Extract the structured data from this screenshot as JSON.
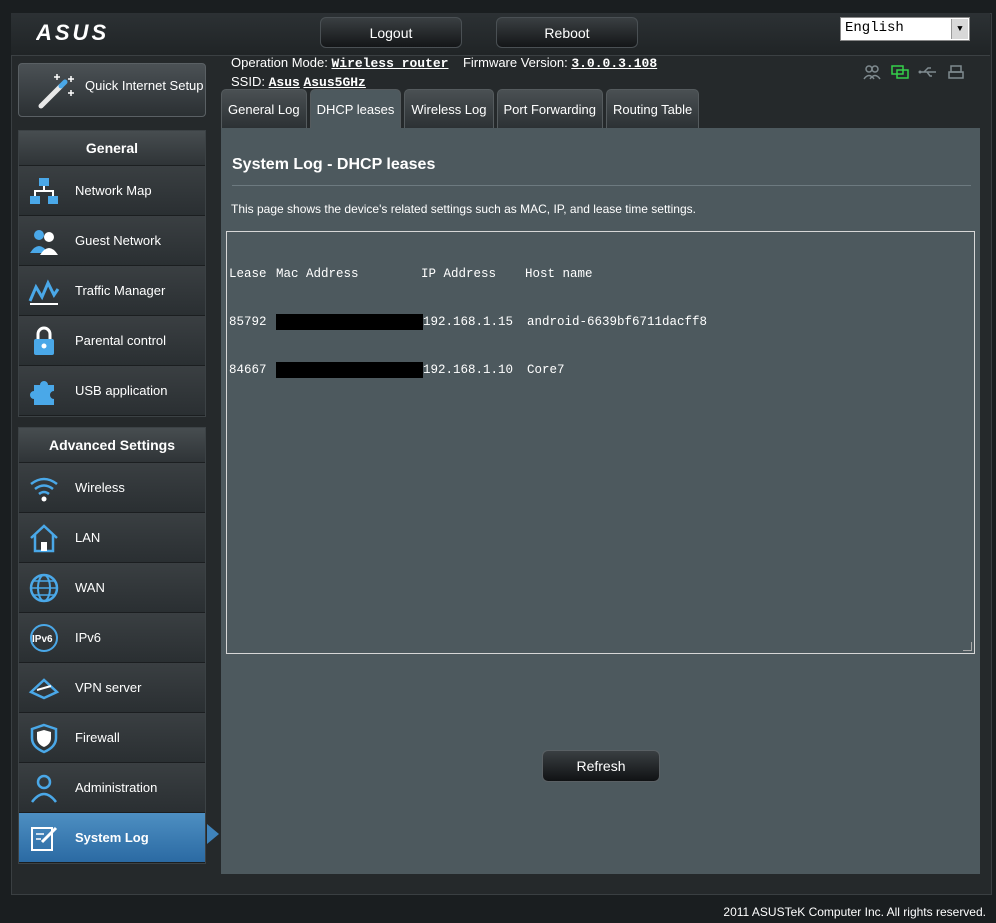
{
  "header": {
    "logo": "/ISUS",
    "logout_label": "Logout",
    "reboot_label": "Reboot",
    "language": "English"
  },
  "info": {
    "operation_mode_label": "Operation Mode:",
    "operation_mode_value": "Wireless router",
    "firmware_label": "Firmware Version:",
    "firmware_value": "3.0.0.3.108",
    "ssid_label": "SSID:",
    "ssid_1": "Asus",
    "ssid_2": "Asus5GHz"
  },
  "status_icons": [
    "clients-icon",
    "network-icon",
    "usb-icon",
    "printer-icon"
  ],
  "sidebar": {
    "qis_label": "Quick Internet Setup",
    "general_title": "General",
    "general_items": [
      {
        "label": "Network Map",
        "icon": "network-map-icon"
      },
      {
        "label": "Guest Network",
        "icon": "guest-network-icon"
      },
      {
        "label": "Traffic Manager",
        "icon": "traffic-manager-icon"
      },
      {
        "label": "Parental control",
        "icon": "lock-icon"
      },
      {
        "label": "USB application",
        "icon": "puzzle-icon"
      }
    ],
    "advanced_title": "Advanced Settings",
    "advanced_items": [
      {
        "label": "Wireless",
        "icon": "wifi-icon"
      },
      {
        "label": "LAN",
        "icon": "house-icon"
      },
      {
        "label": "WAN",
        "icon": "globe-icon"
      },
      {
        "label": "IPv6",
        "icon": "ipv6-icon"
      },
      {
        "label": "VPN server",
        "icon": "vpn-icon"
      },
      {
        "label": "Firewall",
        "icon": "shield-icon"
      },
      {
        "label": "Administration",
        "icon": "admin-user-icon"
      },
      {
        "label": "System Log",
        "icon": "log-icon"
      }
    ]
  },
  "tabs": [
    "General Log",
    "DHCP leases",
    "Wireless Log",
    "Port Forwarding",
    "Routing Table"
  ],
  "active_tab": "DHCP leases",
  "main": {
    "title": "System Log - DHCP leases",
    "description": "This page shows the device's related settings such as MAC, IP, and lease time settings.",
    "log_headers": [
      "Lease",
      "Mac Address",
      "IP Address",
      "Host name"
    ],
    "log_rows": [
      {
        "lease": "85792",
        "mac": "",
        "ip": "192.168.1.15",
        "host": "android-6639bf6711dacff8"
      },
      {
        "lease": "84667",
        "mac": "",
        "ip": "192.168.1.10",
        "host": "Core7"
      }
    ],
    "refresh_label": "Refresh"
  },
  "footer": "2011 ASUSTeK Computer Inc. All rights reserved.",
  "colors": {
    "accent": "#3f83bb",
    "panel": "#4d595e",
    "background": "#1a1e20"
  }
}
